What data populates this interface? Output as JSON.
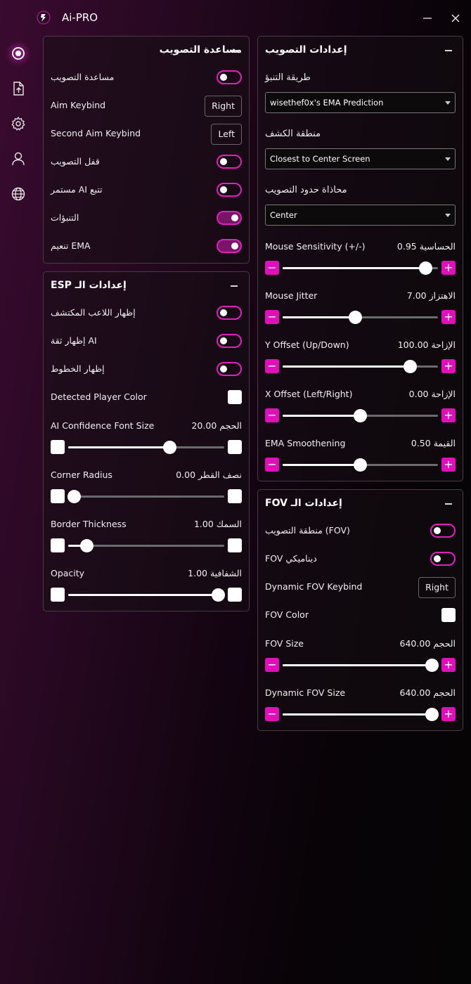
{
  "app": {
    "title": "Ai-PRO"
  },
  "colors": {
    "accent": "#e010b8",
    "background_left": "#3a0a30",
    "background_right": "#050505"
  },
  "sidebar": {
    "items": [
      {
        "icon": "target-icon",
        "active": true
      },
      {
        "icon": "upload-file-icon",
        "active": false
      },
      {
        "icon": "gear-icon",
        "active": false
      },
      {
        "icon": "user-icon",
        "active": false
      },
      {
        "icon": "globe-icon",
        "active": false
      }
    ]
  },
  "aim_assist": {
    "title": "مساعدة التصويب",
    "rows": [
      {
        "label": "مساعدة التصويب",
        "type": "toggle",
        "on": false
      },
      {
        "label": "Aim Keybind",
        "type": "key",
        "value": "Right"
      },
      {
        "label": "Second Aim Keybind",
        "type": "key",
        "value": "Left"
      },
      {
        "label": "قفل التصويب",
        "type": "toggle",
        "on": false
      },
      {
        "label": "مستمر AI تتبع",
        "type": "toggle",
        "on": false
      },
      {
        "label": "التنبؤات",
        "type": "toggle",
        "on": true
      },
      {
        "label": "تنعيم EMA",
        "type": "toggle",
        "on": true
      }
    ]
  },
  "esp": {
    "title": "إعدادات الـ ESP",
    "toggles": [
      {
        "label": "إظهار اللاعب المكتشف",
        "on": false
      },
      {
        "label": "إظهار ثقة AI",
        "on": false
      },
      {
        "label": "إظهار الخطوط",
        "on": false
      }
    ],
    "color_label": "Detected Player Color",
    "sliders": [
      {
        "label": "AI Confidence Font Size",
        "value_text": "الحجم 20.00",
        "fraction": 0.65
      },
      {
        "label": "Corner Radius",
        "value_text": "نصف القطر 0.00",
        "fraction": 0.04
      },
      {
        "label": "Border Thickness",
        "value_text": "السمك 1.00",
        "fraction": 0.12
      },
      {
        "label": "Opacity",
        "value_text": "الشفافية 1.00",
        "fraction": 0.96
      }
    ]
  },
  "aim_settings": {
    "title": "إعدادات التصويب",
    "selects": [
      {
        "label": "طريقة التنبؤ",
        "value": "wisethef0x's EMA Prediction"
      },
      {
        "label": "منطقة الكشف",
        "value": "Closest to Center Screen"
      },
      {
        "label": "محاذاة حدود التصويب",
        "value": "Center"
      }
    ],
    "sliders": [
      {
        "label": "Mouse Sensitivity (+/-)",
        "value_text": "الحساسية 0.95",
        "fraction": 0.92
      },
      {
        "label": "Mouse Jitter",
        "value_text": "الاهتزاز 7.00",
        "fraction": 0.47
      },
      {
        "label": "Y Offset (Up/Down)",
        "value_text": "الإزاحة 100.00",
        "fraction": 0.82
      },
      {
        "label": "X Offset (Left/Right)",
        "value_text": "الإزاحة 0.00",
        "fraction": 0.5
      },
      {
        "label": "EMA Smoothening",
        "value_text": "القيمة 0.50",
        "fraction": 0.5
      }
    ]
  },
  "fov": {
    "title": "إعدادات الـ FOV",
    "rows": [
      {
        "label": "منطقة التصويب (FOV)",
        "type": "toggle",
        "on": false
      },
      {
        "label": "FOV ديناميكي",
        "type": "toggle",
        "on": false
      },
      {
        "label": "Dynamic FOV Keybind",
        "type": "key",
        "value": "Right"
      },
      {
        "label": "FOV Color",
        "type": "color"
      }
    ],
    "sliders": [
      {
        "label": "FOV Size",
        "value_text": "الحجم 640.00",
        "fraction": 0.96
      },
      {
        "label": "Dynamic FOV Size",
        "value_text": "الحجم 640.00",
        "fraction": 0.96
      }
    ]
  }
}
